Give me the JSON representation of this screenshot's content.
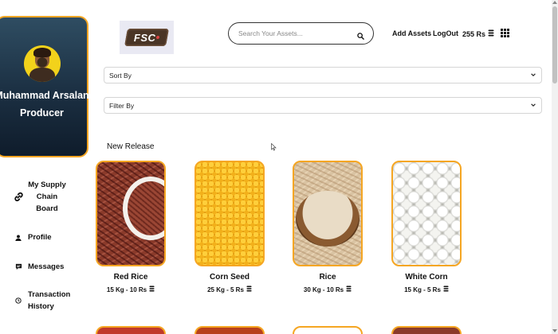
{
  "profile": {
    "name": "Muhammad Arsalan",
    "role": "Producer"
  },
  "sidebar": {
    "items": [
      {
        "label": "My Supply Chain Board",
        "icon": "link-icon"
      },
      {
        "label": "Profile",
        "icon": "user-icon"
      },
      {
        "label": "Messages",
        "icon": "message-icon"
      },
      {
        "label": "Transaction History",
        "icon": "history-icon"
      }
    ]
  },
  "header": {
    "logo_text": "FSC",
    "search_placeholder": "Search Your Assets...",
    "add_assets": "Add Assets",
    "logout": "LogOut",
    "balance": "255 Rs"
  },
  "filters": {
    "sort_label": "Sort By",
    "filter_label": "Filter By"
  },
  "section": {
    "title": "New Release"
  },
  "products": [
    {
      "name": "Red Rice",
      "price": "15 Kg - 10 Rs"
    },
    {
      "name": "Corn Seed",
      "price": "25 Kg - 5 Rs"
    },
    {
      "name": "Rice",
      "price": "30 Kg - 10 Rs"
    },
    {
      "name": "White Corn",
      "price": "15 Kg - 5 Rs"
    }
  ],
  "colors": {
    "accent": "#f5a623",
    "profile_bg": "#1b2f42"
  }
}
